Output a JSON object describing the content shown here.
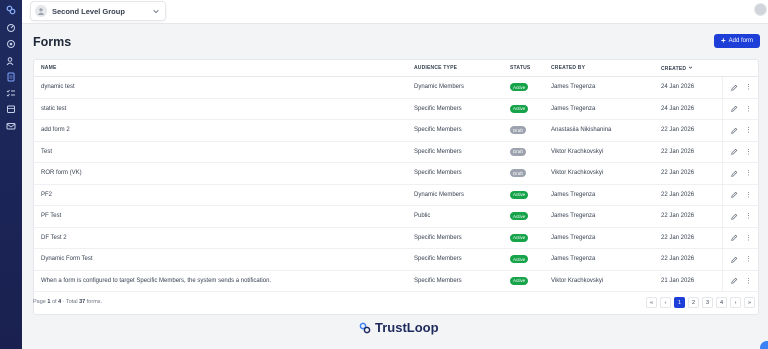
{
  "sidebar": {
    "icons": [
      "logo-icon",
      "dashboard-icon",
      "settings-icon",
      "members-icon",
      "forms-icon",
      "checklist-icon",
      "archive-icon",
      "mail-icon"
    ]
  },
  "topbar": {
    "group_name": "Second Level Group"
  },
  "page": {
    "title": "Forms",
    "add_button": "Add form"
  },
  "table": {
    "headers": {
      "name": "NAME",
      "audience": "AUDIENCE TYPE",
      "status": "STATUS",
      "created_by": "CREATED BY",
      "created": "CREATED"
    },
    "rows": [
      {
        "name": "dynamic test",
        "audience": "Dynamic Members",
        "status": "Active",
        "created_by": "James Tregenza",
        "created": "24 Jan 2026"
      },
      {
        "name": "static test",
        "audience": "Specific Members",
        "status": "Active",
        "created_by": "James Tregenza",
        "created": "24 Jan 2026"
      },
      {
        "name": "add form 2",
        "audience": "Specific Members",
        "status": "Draft",
        "created_by": "Anastasiia Nikishanina",
        "created": "22 Jan 2026"
      },
      {
        "name": "Test",
        "audience": "Specific Members",
        "status": "Draft",
        "created_by": "Viktor Krachkovskyi",
        "created": "22 Jan 2026"
      },
      {
        "name": "ROR form (VK)",
        "audience": "Specific Members",
        "status": "Draft",
        "created_by": "Viktor Krachkovskyi",
        "created": "22 Jan 2026"
      },
      {
        "name": "PF2",
        "audience": "Dynamic Members",
        "status": "Active",
        "created_by": "James Tregenza",
        "created": "22 Jan 2026"
      },
      {
        "name": "PF Test",
        "audience": "Public",
        "status": "Active",
        "created_by": "James Tregenza",
        "created": "22 Jan 2026"
      },
      {
        "name": "DF Test 2",
        "audience": "Specific Members",
        "status": "Active",
        "created_by": "James Tregenza",
        "created": "22 Jan 2026"
      },
      {
        "name": "Dynamic Form Test",
        "audience": "Specific Members",
        "status": "Active",
        "created_by": "James Tregenza",
        "created": "22 Jan 2026"
      },
      {
        "name": "When a form is configured to target Specific Members, the system sends a notification.",
        "audience": "Specific Members",
        "status": "Active",
        "created_by": "Viktor Krachkovskyi",
        "created": "21 Jan 2026"
      }
    ]
  },
  "footer": {
    "page_prefix": "Page",
    "page_current": "1",
    "page_of": "of",
    "page_total": "4",
    "total_prefix": "Total",
    "total_count": "37",
    "total_suffix": "forms",
    "pages": [
      "1",
      "2",
      "3",
      "4"
    ],
    "first_label": "«",
    "prev_label": "‹",
    "next_label": "›",
    "last_label": "»"
  },
  "brand": {
    "name": "TrustLoop"
  },
  "colors": {
    "sidebar": "#1e2a5e",
    "primary": "#1d3fd8",
    "active": "#16a34a",
    "draft": "#9ca3af"
  }
}
